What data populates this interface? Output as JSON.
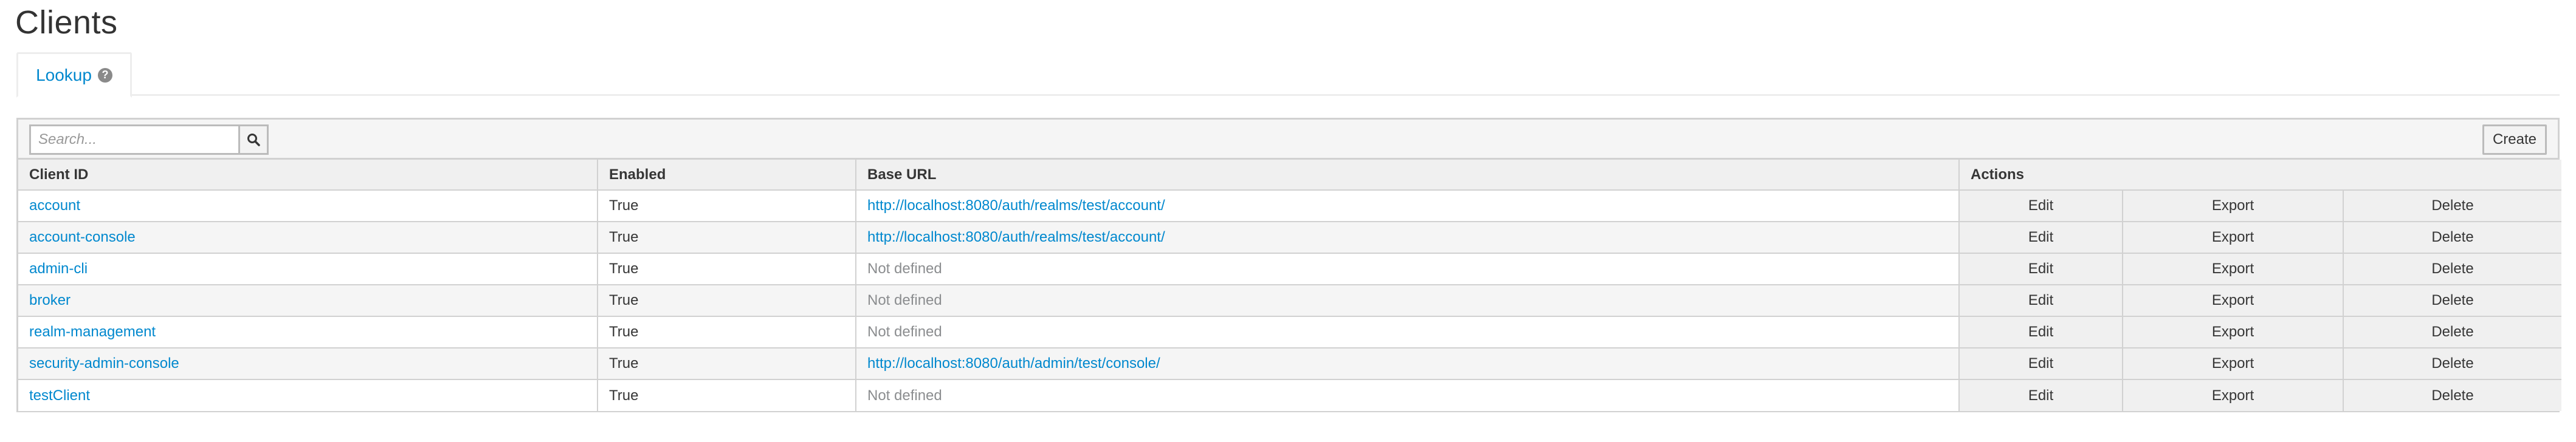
{
  "page": {
    "title": "Clients"
  },
  "tabs": [
    {
      "label": "Lookup"
    }
  ],
  "toolbar": {
    "search_placeholder": "Search...",
    "create_label": "Create"
  },
  "table": {
    "headers": {
      "client_id": "Client ID",
      "enabled": "Enabled",
      "base_url": "Base URL",
      "actions": "Actions"
    },
    "rows": [
      {
        "client_id": "account",
        "enabled": "True",
        "base_url": "http://localhost:8080/auth/realms/test/account/",
        "url_defined": true,
        "edit": "Edit",
        "export": "Export",
        "delete": "Delete"
      },
      {
        "client_id": "account-console",
        "enabled": "True",
        "base_url": "http://localhost:8080/auth/realms/test/account/",
        "url_defined": true,
        "edit": "Edit",
        "export": "Export",
        "delete": "Delete"
      },
      {
        "client_id": "admin-cli",
        "enabled": "True",
        "base_url": "Not defined",
        "url_defined": false,
        "edit": "Edit",
        "export": "Export",
        "delete": "Delete"
      },
      {
        "client_id": "broker",
        "enabled": "True",
        "base_url": "Not defined",
        "url_defined": false,
        "edit": "Edit",
        "export": "Export",
        "delete": "Delete"
      },
      {
        "client_id": "realm-management",
        "enabled": "True",
        "base_url": "Not defined",
        "url_defined": false,
        "edit": "Edit",
        "export": "Export",
        "delete": "Delete"
      },
      {
        "client_id": "security-admin-console",
        "enabled": "True",
        "base_url": "http://localhost:8080/auth/admin/test/console/",
        "url_defined": true,
        "edit": "Edit",
        "export": "Export",
        "delete": "Delete"
      },
      {
        "client_id": "testClient",
        "enabled": "True",
        "base_url": "Not defined",
        "url_defined": false,
        "edit": "Edit",
        "export": "Export",
        "delete": "Delete"
      }
    ]
  },
  "colors": {
    "link": "#0088ce",
    "muted": "#8b8d8f",
    "border": "#d1d1d1"
  },
  "icons": {
    "help": "question-circle-icon",
    "search": "search-icon"
  }
}
